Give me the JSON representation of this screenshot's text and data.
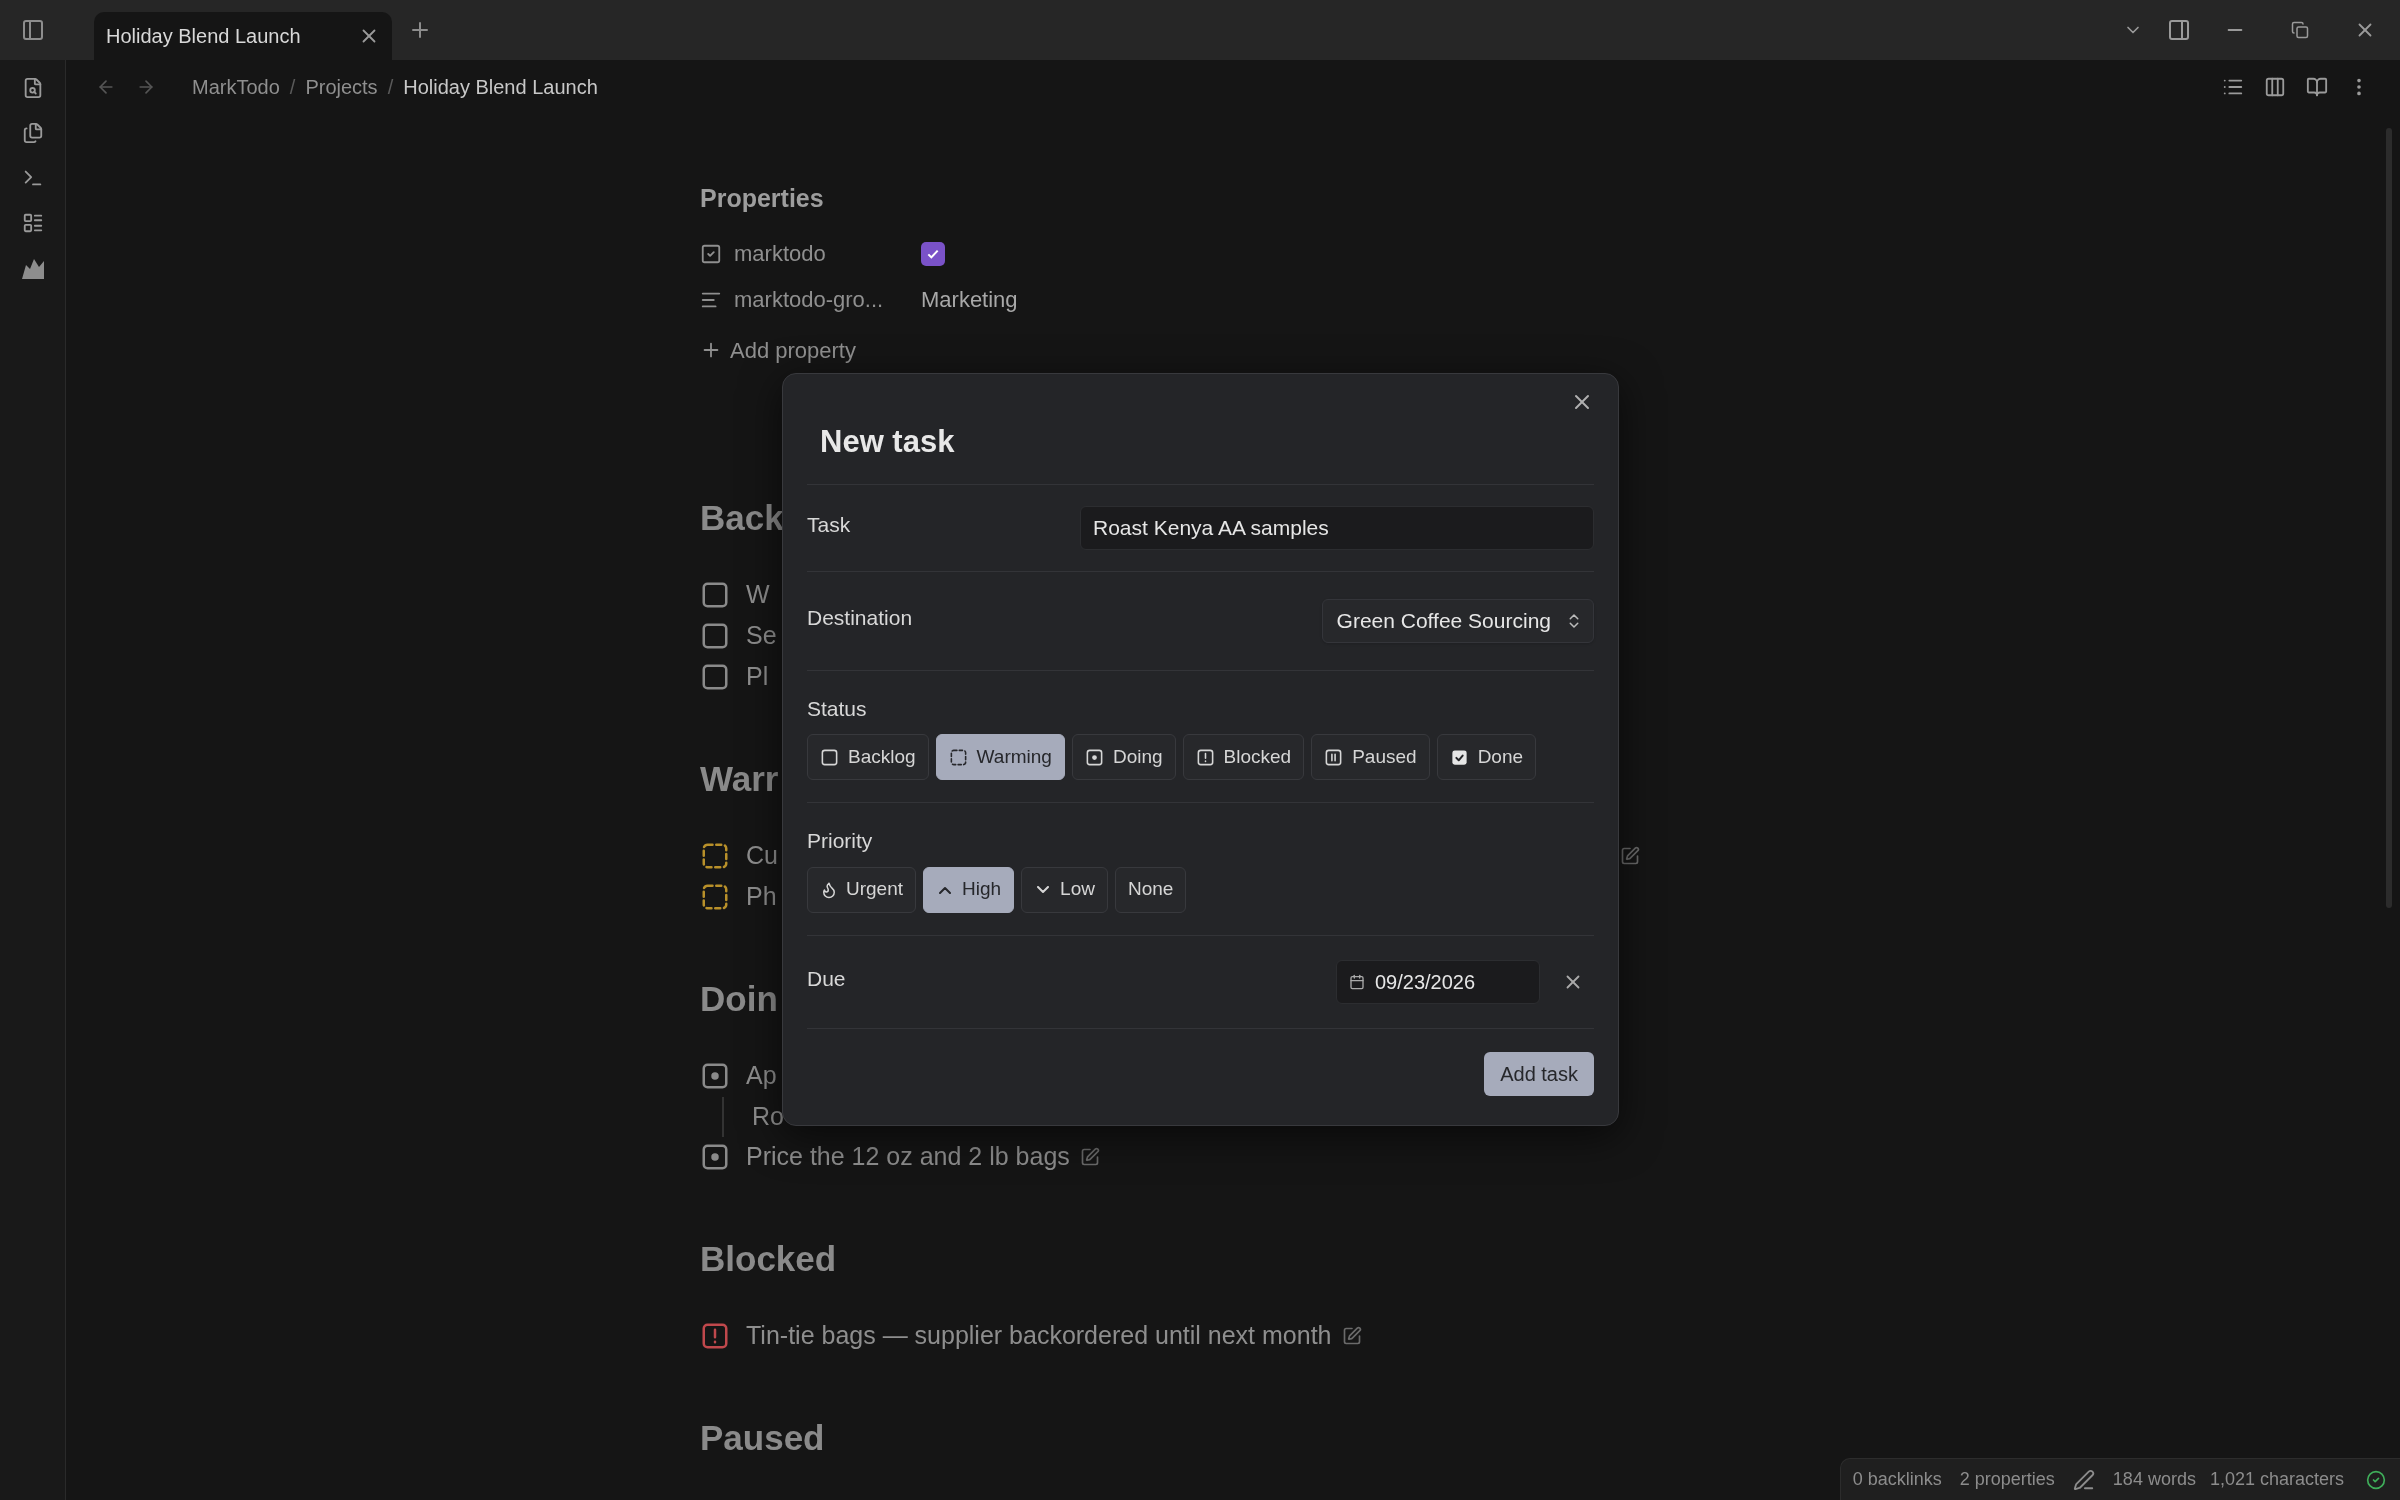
{
  "tab": {
    "title": "Holiday Blend Launch",
    "selected": true
  },
  "breadcrumb": [
    {
      "kind": "link",
      "text": "MarkTodo"
    },
    {
      "kind": "separator",
      "text": "/"
    },
    {
      "kind": "link",
      "text": "Projects"
    },
    {
      "kind": "separator",
      "text": "/"
    },
    {
      "kind": "current",
      "text": "Holiday Blend Launch"
    }
  ],
  "properties": {
    "heading": "Properties",
    "rows": [
      {
        "kind": "checkbox",
        "name": "marktodo",
        "checked": true
      },
      {
        "kind": "text",
        "name": "marktodo-gro...",
        "value": "Marketing"
      }
    ],
    "add": "Add property"
  },
  "sections": [
    {
      "heading": "Back",
      "items": [
        {
          "kind": "backlog",
          "text": "W"
        },
        {
          "kind": "backlog",
          "text": "Se"
        },
        {
          "kind": "backlog",
          "text": "Pl"
        }
      ]
    },
    {
      "heading": "Warr",
      "items": [
        {
          "kind": "warming",
          "text": "Cu",
          "cut": true,
          "edit": true
        },
        {
          "kind": "warming",
          "text": "Ph"
        }
      ]
    },
    {
      "heading": "Doin",
      "items": [
        {
          "kind": "doing",
          "text": "Ap",
          "note": "Ro"
        },
        {
          "kind": "doing",
          "text": "Price the 12 oz and 2 lb bags",
          "edit": true
        }
      ]
    },
    {
      "heading": "Blocked",
      "items": [
        {
          "kind": "blocked",
          "text": "Tin-tie bags — supplier backordered until next month",
          "edit": true
        }
      ]
    },
    {
      "heading": "Paused"
    }
  ],
  "dialog": {
    "title": "New task",
    "task": {
      "label": "Task",
      "value": "Roast Kenya AA samples"
    },
    "destination": {
      "label": "Destination",
      "value": "Green Coffee Sourcing"
    },
    "status": {
      "label": "Status",
      "options": [
        {
          "kind": "backlog",
          "label": "Backlog",
          "selected": false
        },
        {
          "kind": "warming",
          "label": "Warming",
          "selected": true
        },
        {
          "kind": "doing",
          "label": "Doing",
          "selected": false
        },
        {
          "kind": "blocked",
          "label": "Blocked",
          "selected": false
        },
        {
          "kind": "paused",
          "label": "Paused",
          "selected": false
        },
        {
          "kind": "done",
          "label": "Done",
          "selected": false
        }
      ]
    },
    "priority": {
      "label": "Priority",
      "options": [
        {
          "kind": "urgent",
          "label": "Urgent",
          "selected": false
        },
        {
          "kind": "high",
          "label": "High",
          "selected": true
        },
        {
          "kind": "low",
          "label": "Low",
          "selected": false
        },
        {
          "kind": "none",
          "label": "None",
          "selected": false
        }
      ]
    },
    "due": {
      "label": "Due",
      "value": "09/23/2026"
    },
    "submit": "Add task"
  },
  "status_bar": {
    "backlinks": "0 backlinks",
    "properties": "2 properties",
    "words": "184 words",
    "characters": "1,021 characters"
  }
}
